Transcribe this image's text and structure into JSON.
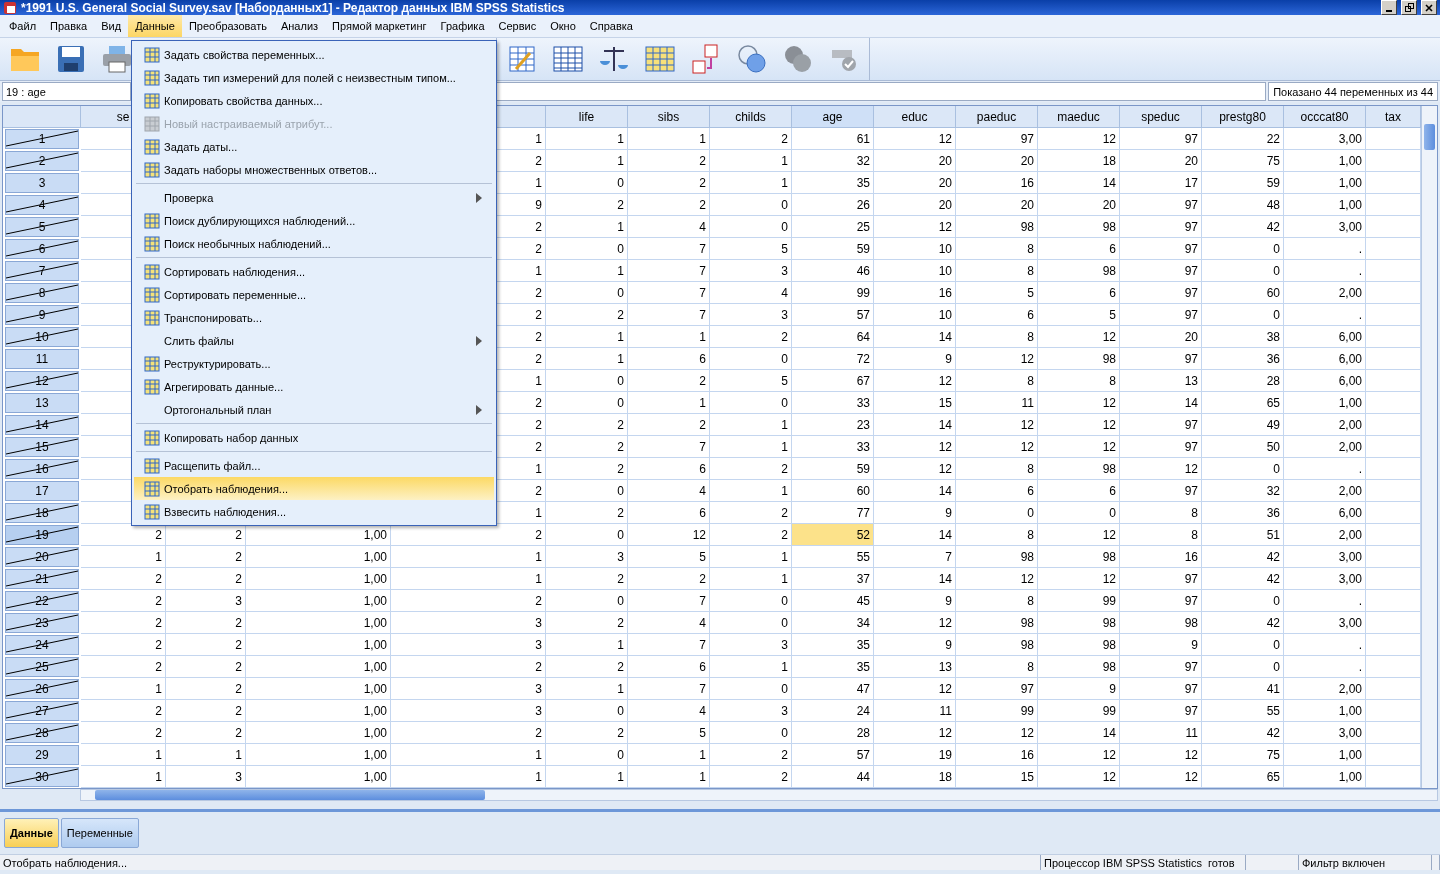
{
  "window": {
    "title": "*1991 U.S. General Social Survey.sav [Наборданных1] - Редактор данных IBM SPSS Statistics"
  },
  "menu_bar": [
    {
      "label": "Файл",
      "selected": false
    },
    {
      "label": "Правка",
      "selected": false
    },
    {
      "label": "Вид",
      "selected": false
    },
    {
      "label": "Данные",
      "selected": true
    },
    {
      "label": "Преобразовать",
      "selected": false
    },
    {
      "label": "Анализ",
      "selected": false
    },
    {
      "label": "Прямой маркетинг",
      "selected": false
    },
    {
      "label": "Графика",
      "selected": false
    },
    {
      "label": "Сервис",
      "selected": false
    },
    {
      "label": "Окно",
      "selected": false
    },
    {
      "label": "Справка",
      "selected": false
    }
  ],
  "dropdown": {
    "groups": [
      [
        {
          "label": "Задать свойства переменных...",
          "disabled": false,
          "highlighted": false,
          "submenu": false
        },
        {
          "label": "Задать тип измерений для полей с неизвестным типом...",
          "disabled": false,
          "highlighted": false,
          "submenu": false
        },
        {
          "label": "Копировать свойства данных...",
          "disabled": false,
          "highlighted": false,
          "submenu": false
        },
        {
          "label": "Новый настраиваемый атрибут...",
          "disabled": true,
          "highlighted": false,
          "submenu": false
        },
        {
          "label": "Задать даты...",
          "disabled": false,
          "highlighted": false,
          "submenu": false
        },
        {
          "label": "Задать наборы множественных ответов...",
          "disabled": false,
          "highlighted": false,
          "submenu": false
        }
      ],
      [
        {
          "label": "Проверка",
          "disabled": false,
          "highlighted": false,
          "submenu": true
        },
        {
          "label": "Поиск дублирующихся наблюдений...",
          "disabled": false,
          "highlighted": false,
          "submenu": false
        },
        {
          "label": "Поиск необычных наблюдений...",
          "disabled": false,
          "highlighted": false,
          "submenu": false
        }
      ],
      [
        {
          "label": "Сортировать наблюдения...",
          "disabled": false,
          "highlighted": false,
          "submenu": false
        },
        {
          "label": "Сортировать переменные...",
          "disabled": false,
          "highlighted": false,
          "submenu": false
        },
        {
          "label": "Транспонировать...",
          "disabled": false,
          "highlighted": false,
          "submenu": false
        },
        {
          "label": "Слить файлы",
          "disabled": false,
          "highlighted": false,
          "submenu": true
        },
        {
          "label": "Реструктурировать...",
          "disabled": false,
          "highlighted": false,
          "submenu": false
        },
        {
          "label": "Агрегировать данные...",
          "disabled": false,
          "highlighted": false,
          "submenu": false
        },
        {
          "label": "Ортогональный план",
          "disabled": false,
          "highlighted": false,
          "submenu": true
        }
      ],
      [
        {
          "label": "Копировать набор данных",
          "disabled": false,
          "highlighted": false,
          "submenu": false
        }
      ],
      [
        {
          "label": "Расщепить файл...",
          "disabled": false,
          "highlighted": false,
          "submenu": false
        },
        {
          "label": "Отобрать наблюдения...",
          "disabled": false,
          "highlighted": true,
          "submenu": false
        },
        {
          "label": "Взвесить наблюдения...",
          "disabled": false,
          "highlighted": false,
          "submenu": false
        }
      ]
    ]
  },
  "cell_editor": {
    "reference": "19 : age",
    "shown": "Показано 44 переменных из 44"
  },
  "table": {
    "columns": [
      {
        "name": "se",
        "selected": false
      },
      {},
      {},
      {
        "selected": false
      },
      {
        "name": "life",
        "selected": false
      },
      {
        "name": "sibs",
        "selected": false
      },
      {
        "name": "childs",
        "selected": false
      },
      {
        "name": "age",
        "selected": true
      },
      {
        "name": "educ",
        "selected": false
      },
      {
        "name": "paeduc",
        "selected": false
      },
      {
        "name": "maeduc",
        "selected": false
      },
      {
        "name": "speduc",
        "selected": false
      },
      {
        "name": "prestg80",
        "selected": false
      },
      {
        "name": "occcat80",
        "selected": false
      },
      {
        "name": "tax",
        "selected": false
      }
    ],
    "rows": [
      {
        "number": "1",
        "filtered_out": true,
        "selected": false,
        "cells": [
          "1",
          "1",
          "1",
          "2",
          "61",
          "12",
          "97",
          "12",
          "97",
          "22",
          "3,00"
        ]
      },
      {
        "number": "2",
        "filtered_out": true,
        "selected": false,
        "cells": [
          "2",
          "1",
          "2",
          "1",
          "32",
          "20",
          "20",
          "18",
          "20",
          "75",
          "1,00"
        ]
      },
      {
        "number": "3",
        "filtered_out": false,
        "selected": false,
        "cells": [
          "1",
          "0",
          "2",
          "1",
          "35",
          "20",
          "16",
          "14",
          "17",
          "59",
          "1,00"
        ]
      },
      {
        "number": "4",
        "filtered_out": true,
        "selected": false,
        "cells": [
          "9",
          "2",
          "2",
          "0",
          "26",
          "20",
          "20",
          "20",
          "97",
          "48",
          "1,00"
        ]
      },
      {
        "number": "5",
        "filtered_out": true,
        "selected": false,
        "cells": [
          "2",
          "1",
          "4",
          "0",
          "25",
          "12",
          "98",
          "98",
          "97",
          "42",
          "3,00"
        ]
      },
      {
        "number": "6",
        "filtered_out": true,
        "selected": false,
        "cells": [
          "2",
          "0",
          "7",
          "5",
          "59",
          "10",
          "8",
          "6",
          "97",
          "0",
          "."
        ]
      },
      {
        "number": "7",
        "filtered_out": true,
        "selected": false,
        "cells": [
          "1",
          "1",
          "7",
          "3",
          "46",
          "10",
          "8",
          "98",
          "97",
          "0",
          "."
        ]
      },
      {
        "number": "8",
        "filtered_out": true,
        "selected": false,
        "cells": [
          "2",
          "0",
          "7",
          "4",
          "99",
          "16",
          "5",
          "6",
          "97",
          "60",
          "2,00"
        ]
      },
      {
        "number": "9",
        "filtered_out": true,
        "selected": false,
        "cells": [
          "2",
          "2",
          "7",
          "3",
          "57",
          "10",
          "6",
          "5",
          "97",
          "0",
          "."
        ]
      },
      {
        "number": "10",
        "filtered_out": true,
        "selected": false,
        "cells": [
          "2",
          "1",
          "1",
          "2",
          "64",
          "14",
          "8",
          "12",
          "20",
          "38",
          "6,00"
        ]
      },
      {
        "number": "11",
        "filtered_out": false,
        "selected": false,
        "cells": [
          "2",
          "1",
          "6",
          "0",
          "72",
          "9",
          "12",
          "98",
          "97",
          "36",
          "6,00"
        ]
      },
      {
        "number": "12",
        "filtered_out": true,
        "selected": false,
        "cells": [
          "1",
          "0",
          "2",
          "5",
          "67",
          "12",
          "8",
          "8",
          "13",
          "28",
          "6,00"
        ]
      },
      {
        "number": "13",
        "filtered_out": false,
        "selected": false,
        "cells": [
          "2",
          "0",
          "1",
          "0",
          "33",
          "15",
          "11",
          "12",
          "14",
          "65",
          "1,00"
        ]
      },
      {
        "number": "14",
        "filtered_out": true,
        "selected": false,
        "cells": [
          "2",
          "2",
          "2",
          "1",
          "23",
          "14",
          "12",
          "12",
          "97",
          "49",
          "2,00"
        ]
      },
      {
        "number": "15",
        "filtered_out": true,
        "selected": false,
        "cells": [
          "2",
          "2",
          "7",
          "1",
          "33",
          "12",
          "12",
          "12",
          "97",
          "50",
          "2,00"
        ]
      },
      {
        "number": "16",
        "filtered_out": true,
        "selected": false,
        "cells": [
          "1",
          "2",
          "6",
          "2",
          "59",
          "12",
          "8",
          "98",
          "12",
          "0",
          "."
        ]
      },
      {
        "number": "17",
        "filtered_out": false,
        "selected": false,
        "cells": [
          "2",
          "0",
          "4",
          "1",
          "60",
          "14",
          "6",
          "6",
          "97",
          "32",
          "2,00"
        ]
      },
      {
        "number": "18",
        "filtered_out": true,
        "selected": false,
        "cells": [
          "1",
          "2",
          "6",
          "2",
          "77",
          "9",
          "0",
          "0",
          "8",
          "36",
          "6,00"
        ]
      },
      {
        "number": "19",
        "filtered_out": true,
        "selected": true,
        "cells": [
          "2",
          "2",
          "1,00",
          "2",
          "0",
          "12",
          "2",
          "52",
          "14",
          "8",
          "12",
          "8",
          "51",
          "2,00"
        ]
      },
      {
        "number": "20",
        "filtered_out": true,
        "selected": false,
        "cells": [
          "1",
          "2",
          "1,00",
          "1",
          "3",
          "5",
          "1",
          "55",
          "7",
          "98",
          "98",
          "16",
          "42",
          "3,00"
        ]
      },
      {
        "number": "21",
        "filtered_out": true,
        "selected": false,
        "cells": [
          "2",
          "2",
          "1,00",
          "1",
          "2",
          "2",
          "1",
          "37",
          "14",
          "12",
          "12",
          "97",
          "42",
          "3,00"
        ]
      },
      {
        "number": "22",
        "filtered_out": true,
        "selected": false,
        "cells": [
          "2",
          "3",
          "1,00",
          "2",
          "0",
          "7",
          "0",
          "45",
          "9",
          "8",
          "99",
          "97",
          "0",
          "."
        ]
      },
      {
        "number": "23",
        "filtered_out": true,
        "selected": false,
        "cells": [
          "2",
          "2",
          "1,00",
          "3",
          "2",
          "4",
          "0",
          "34",
          "12",
          "98",
          "98",
          "98",
          "42",
          "3,00"
        ]
      },
      {
        "number": "24",
        "filtered_out": true,
        "selected": false,
        "cells": [
          "2",
          "2",
          "1,00",
          "3",
          "1",
          "7",
          "3",
          "35",
          "9",
          "98",
          "98",
          "9",
          "0",
          "."
        ]
      },
      {
        "number": "25",
        "filtered_out": true,
        "selected": false,
        "cells": [
          "2",
          "2",
          "1,00",
          "2",
          "2",
          "6",
          "1",
          "35",
          "13",
          "8",
          "98",
          "97",
          "0",
          "."
        ]
      },
      {
        "number": "26",
        "filtered_out": true,
        "selected": false,
        "cells": [
          "1",
          "2",
          "1,00",
          "3",
          "1",
          "7",
          "0",
          "47",
          "12",
          "97",
          "9",
          "97",
          "41",
          "2,00"
        ]
      },
      {
        "number": "27",
        "filtered_out": true,
        "selected": false,
        "cells": [
          "2",
          "2",
          "1,00",
          "3",
          "0",
          "4",
          "3",
          "24",
          "11",
          "99",
          "99",
          "97",
          "55",
          "1,00"
        ]
      },
      {
        "number": "28",
        "filtered_out": true,
        "selected": false,
        "cells": [
          "2",
          "2",
          "1,00",
          "2",
          "2",
          "5",
          "0",
          "28",
          "12",
          "12",
          "14",
          "11",
          "42",
          "3,00"
        ]
      },
      {
        "number": "29",
        "filtered_out": false,
        "selected": false,
        "cells": [
          "1",
          "1",
          "1,00",
          "1",
          "0",
          "1",
          "2",
          "57",
          "19",
          "16",
          "12",
          "12",
          "75",
          "1,00"
        ]
      },
      {
        "number": "30",
        "filtered_out": true,
        "selected": false,
        "cells": [
          "1",
          "3",
          "1,00",
          "1",
          "1",
          "1",
          "2",
          "44",
          "18",
          "15",
          "12",
          "12",
          "65",
          "1,00"
        ]
      }
    ]
  },
  "view_tabs": [
    {
      "label": "Данные",
      "selected": true
    },
    {
      "label": "Переменные",
      "selected": false
    }
  ],
  "status_bar": {
    "message": "Отобрать наблюдения...",
    "processor": "Процессор IBM SPSS Statistics  готов",
    "filter": "Фильтр включен"
  }
}
